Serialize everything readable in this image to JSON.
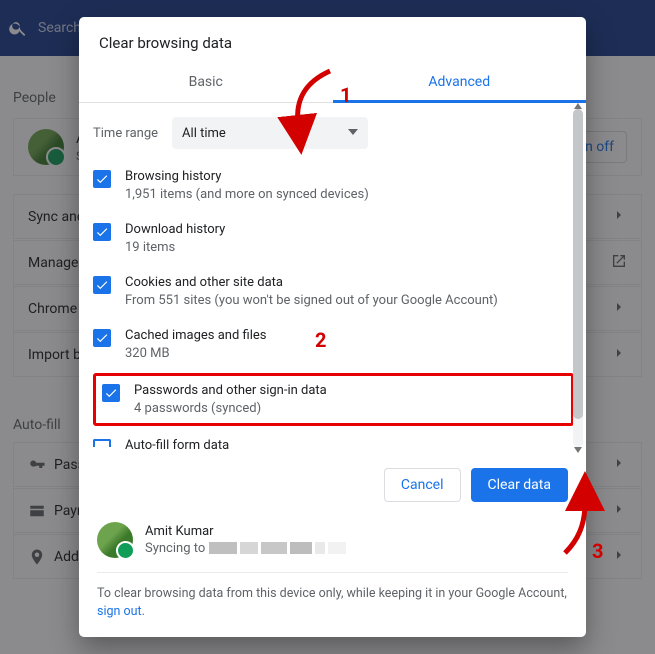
{
  "bg": {
    "search_placeholder": "Search",
    "people_title": "People",
    "autofill_title": "Auto-fill",
    "account_initial": "A",
    "account_sub": "S",
    "turn_off": "Turn off",
    "rows": {
      "sync": "Sync and G",
      "manage": "Manage yo",
      "chromename": "Chrome na",
      "import": "Import boo",
      "passwords": "Pass",
      "payment": "Payr",
      "addresses": "Add"
    }
  },
  "dialog": {
    "title": "Clear browsing data",
    "tabs": {
      "basic": "Basic",
      "advanced": "Advanced"
    },
    "time_range_label": "Time range",
    "time_range_value": "All time",
    "items": [
      {
        "title": "Browsing history",
        "sub": "1,951 items (and more on synced devices)"
      },
      {
        "title": "Download history",
        "sub": "19 items"
      },
      {
        "title": "Cookies and other site data",
        "sub": "From 551 sites (you won't be signed out of your Google Account)"
      },
      {
        "title": "Cached images and files",
        "sub": "320 MB"
      },
      {
        "title": "Passwords and other sign-in data",
        "sub": "4 passwords (synced)"
      },
      {
        "title": "Auto-fill form data",
        "sub": ""
      }
    ],
    "buttons": {
      "cancel": "Cancel",
      "clear": "Clear data"
    },
    "account": {
      "name": "Amit Kumar",
      "sync_prefix": "Syncing to"
    },
    "footnote_pre": "To clear browsing data from this device only, while keeping it in your Google Account, ",
    "footnote_link": "sign out",
    "footnote_post": "."
  },
  "annotations": {
    "n1": "1",
    "n2": "2",
    "n3": "3"
  }
}
